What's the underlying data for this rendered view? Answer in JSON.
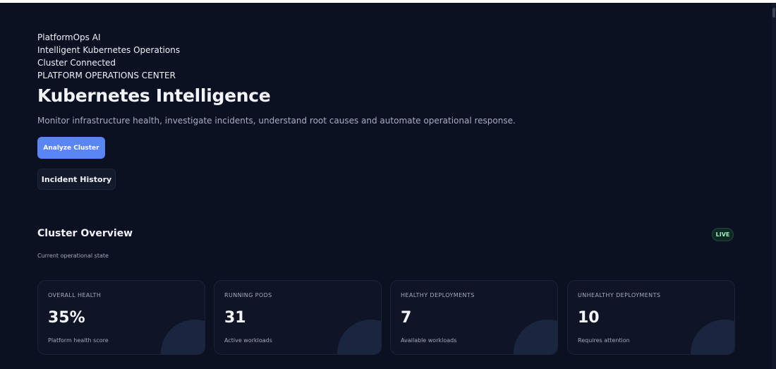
{
  "header": {
    "brand": "PlatformOps AI",
    "tagline": "Intelligent Kubernetes Operations",
    "connection_status": "Cluster Connected",
    "section_label": "PLATFORM OPERATIONS CENTER"
  },
  "hero": {
    "title": "Kubernetes Intelligence",
    "subtitle": "Monitor infrastructure health, investigate incidents, understand root causes and automate operational response.",
    "primary_button": "Analyze Cluster",
    "secondary_button": "Incident History"
  },
  "overview": {
    "title": "Cluster Overview",
    "subtitle": "Current operational state",
    "badge": "LIVE",
    "cards": [
      {
        "label": "OVERALL HEALTH",
        "value": "35%",
        "caption": "Platform health score"
      },
      {
        "label": "RUNNING PODS",
        "value": "31",
        "caption": "Active workloads"
      },
      {
        "label": "HEALTHY DEPLOYMENTS",
        "value": "7",
        "caption": "Available workloads"
      },
      {
        "label": "UNHEALTHY DEPLOYMENTS",
        "value": "10",
        "caption": "Requires attention"
      }
    ]
  },
  "colors": {
    "background": "#0c1122",
    "accent": "#5a86f5",
    "card_background": "#0f1526",
    "live_badge_text": "#9ff0c4"
  }
}
